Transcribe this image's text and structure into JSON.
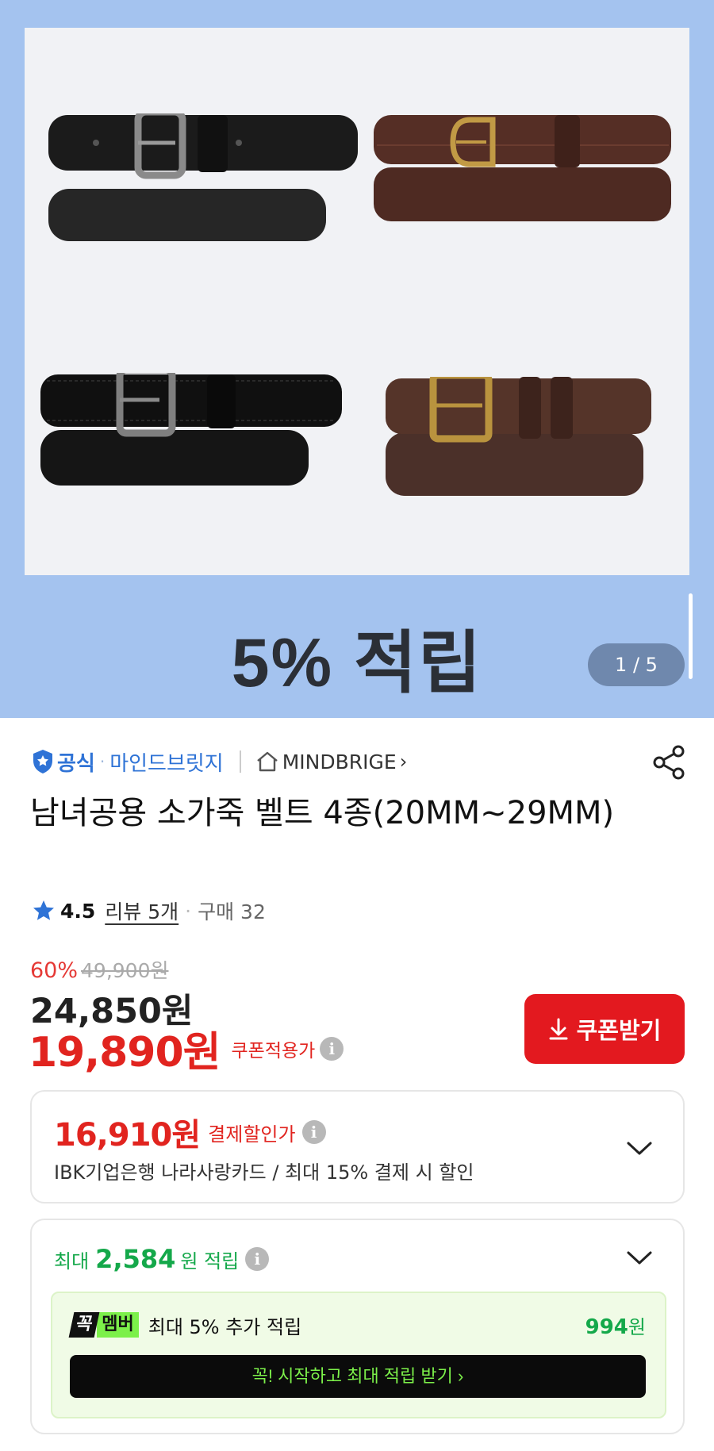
{
  "gallery": {
    "banner_text": "5% 적립",
    "pager": "1 / 5",
    "belt_colors": [
      "#1b1b1b",
      "#4e2a22",
      "#101010",
      "#4b3029"
    ],
    "buckle_colors": [
      "#8a8a8a",
      "#c19a45",
      "#7f7f7f",
      "#b9933e"
    ]
  },
  "brand": {
    "official_label": "공식",
    "brand_name": "마인드브릿지",
    "store_name": "MINDBRIGE",
    "chevron": "›"
  },
  "product": {
    "title": "남녀공용 소가죽 벨트 4종(20MM~29MM)"
  },
  "rating": {
    "score": "4.5",
    "reviews": "리뷰 5개",
    "purchases": "구매 32"
  },
  "pricing": {
    "discount_rate": "60%",
    "original_price": "49,900원",
    "price": "24,850원",
    "coupon_price": "19,890원",
    "coupon_price_label": "쿠폰적용가",
    "coupon_button": "쿠폰받기"
  },
  "payment": {
    "price": "16,910원",
    "label": "결제할인가",
    "description": "IBK기업은행 나라사랑카드 / 최대 15% 결제 시 할인"
  },
  "points": {
    "prefix": "최대",
    "amount": "2,584",
    "suffix": "원 적립",
    "member_badge_1": "꼭",
    "member_badge_2": "멤버",
    "member_text": "최대 5% 추가 적립",
    "member_amount": "994",
    "member_unit": "원",
    "start_button": "꼭! 시작하고 최대 적립 받기  ›"
  },
  "icons": {
    "official": "shield-check-icon",
    "store": "home-icon",
    "share": "share-icon",
    "star": "star-icon",
    "info": "info-icon",
    "coupon": "download-icon",
    "expand": "chevron-down-icon"
  },
  "colors": {
    "accent_red": "#e3191f",
    "brand_blue": "#2f73d6",
    "points_green": "#14a84a",
    "hero_background": "#a4c3ef"
  }
}
